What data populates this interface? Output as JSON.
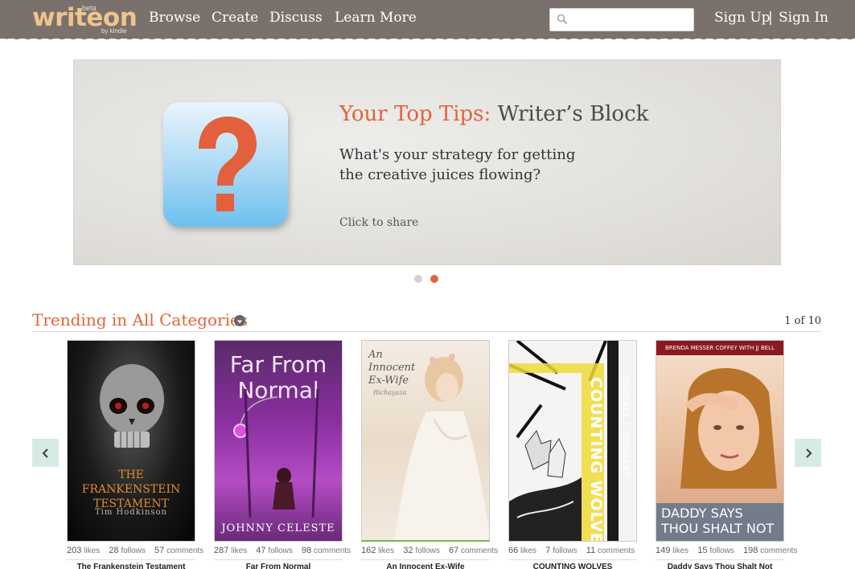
{
  "header": {
    "logo": {
      "main": "writeon",
      "beta": "beta",
      "by": "by kindle"
    },
    "nav": [
      "Browse",
      "Create",
      "Discuss",
      "Learn More"
    ],
    "search": {
      "placeholder": "",
      "value": ""
    },
    "auth": {
      "sign_up": "Sign Up",
      "separator": "|",
      "sign_in": "Sign In"
    }
  },
  "banner": {
    "title_accent": "Your Top Tips:",
    "title_rest": "Writer’s Block",
    "body": "What's your strategy for getting the creative juices flowing?",
    "share": "Click to share",
    "dots_active": 2,
    "dots_total": 2
  },
  "trending": {
    "title": "Trending in All Categories",
    "page": "1 of 10",
    "books": [
      {
        "title": "The Frankenstein Testament",
        "likes": "203",
        "follows": "28",
        "comments": "57",
        "cover_title": "The Frankenstein Testament",
        "cover_author": "Tim Hodkinson"
      },
      {
        "title": "Far From Normal",
        "likes": "287",
        "follows": "47",
        "comments": "98",
        "cover_title": "Far From Normal",
        "cover_author": "JOHNNY CELESTE"
      },
      {
        "title": "An Innocent Ex-Wife",
        "likes": "162",
        "follows": "32",
        "comments": "67",
        "cover_title": "An Innocent Ex-Wife",
        "cover_author": "Richayaza"
      },
      {
        "title": "COUNTING WOLVES",
        "likes": "66",
        "follows": "7",
        "comments": "11",
        "cover_title": "COUNTING WOLVES",
        "cover_author": "MICHAEL F. STEWART"
      },
      {
        "title": "Daddy Says Thou Shalt Not",
        "likes": "149",
        "follows": "15",
        "comments": "198",
        "cover_title": "DADDY SAYS THOU SHALT NOT",
        "cover_author": "BRENDA MESSER COFFEY WITH JJ BELL"
      }
    ],
    "labels": {
      "likes": "likes",
      "follows": "follows",
      "comments": "comments"
    }
  },
  "colors": {
    "header": "#7a716c",
    "accent": "#e0653a",
    "arrow_bg": "#d7ebe6"
  }
}
